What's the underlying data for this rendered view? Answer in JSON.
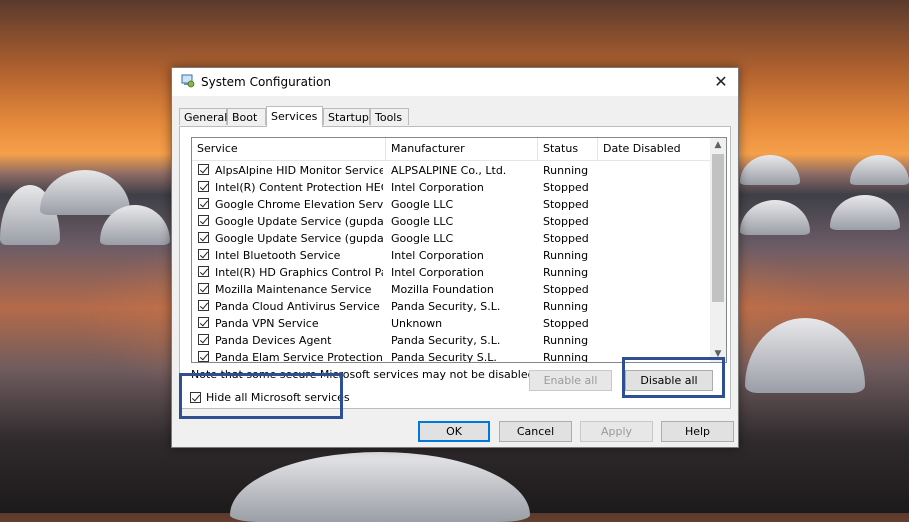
{
  "window": {
    "title": "System Configuration",
    "close_glyph": "✕"
  },
  "tabs": [
    {
      "label": "General",
      "active": false
    },
    {
      "label": "Boot",
      "active": false
    },
    {
      "label": "Services",
      "active": true
    },
    {
      "label": "Startup",
      "active": false
    },
    {
      "label": "Tools",
      "active": false
    }
  ],
  "services": {
    "columns": {
      "service": "Service",
      "manufacturer": "Manufacturer",
      "status": "Status",
      "date_disabled": "Date Disabled"
    },
    "rows": [
      {
        "service": "AlpsAlpine HID Monitor Service",
        "manufacturer": "ALPSALPINE Co., Ltd.",
        "status": "Running",
        "date_disabled": "",
        "checked": true
      },
      {
        "service": "Intel(R) Content Protection HEC...",
        "manufacturer": "Intel Corporation",
        "status": "Stopped",
        "date_disabled": "",
        "checked": true
      },
      {
        "service": "Google Chrome Elevation Servic...",
        "manufacturer": "Google LLC",
        "status": "Stopped",
        "date_disabled": "",
        "checked": true
      },
      {
        "service": "Google Update Service (gupdate)",
        "manufacturer": "Google LLC",
        "status": "Stopped",
        "date_disabled": "",
        "checked": true
      },
      {
        "service": "Google Update Service (gupdatem)",
        "manufacturer": "Google LLC",
        "status": "Stopped",
        "date_disabled": "",
        "checked": true
      },
      {
        "service": "Intel Bluetooth Service",
        "manufacturer": "Intel Corporation",
        "status": "Running",
        "date_disabled": "",
        "checked": true
      },
      {
        "service": "Intel(R) HD Graphics Control Pa...",
        "manufacturer": "Intel Corporation",
        "status": "Running",
        "date_disabled": "",
        "checked": true
      },
      {
        "service": "Mozilla Maintenance Service",
        "manufacturer": "Mozilla Foundation",
        "status": "Stopped",
        "date_disabled": "",
        "checked": true
      },
      {
        "service": "Panda Cloud Antivirus Service",
        "manufacturer": "Panda Security, S.L.",
        "status": "Running",
        "date_disabled": "",
        "checked": true
      },
      {
        "service": "Panda VPN Service",
        "manufacturer": "Unknown",
        "status": "Stopped",
        "date_disabled": "",
        "checked": true
      },
      {
        "service": "Panda Devices Agent",
        "manufacturer": "Panda Security, S.L.",
        "status": "Running",
        "date_disabled": "",
        "checked": true
      },
      {
        "service": "Panda Elam Service Protection",
        "manufacturer": "Panda Security S.L.",
        "status": "Running",
        "date_disabled": "",
        "checked": true
      }
    ]
  },
  "note": "Note that some secure Microsoft services may not be disabled.",
  "buttons": {
    "enable_all": "Enable all",
    "disable_all": "Disable all",
    "ok": "OK",
    "cancel": "Cancel",
    "apply": "Apply",
    "help": "Help"
  },
  "hide_ms": {
    "label": "Hide all Microsoft services",
    "checked": true
  },
  "colors": {
    "highlight": "#2f4f93",
    "default_button": "#0078d7"
  }
}
